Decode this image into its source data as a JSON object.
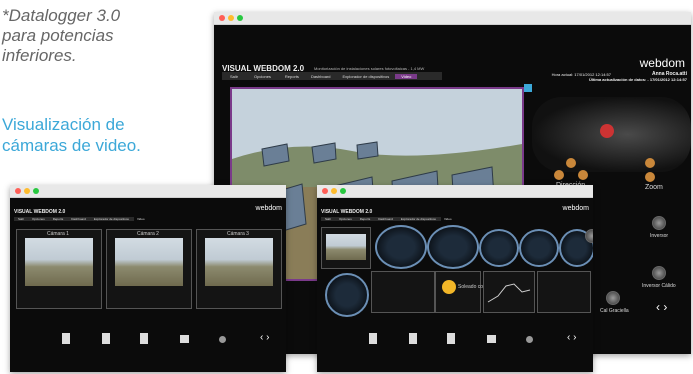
{
  "note": {
    "line1": "*Datalogger 3.0",
    "line2": "para potencias",
    "line3": "inferiores."
  },
  "heading": {
    "line1": "Visualización de",
    "line2": "cámaras de video."
  },
  "main_window": {
    "title": "VISUAL WEBDOM 2.0",
    "subtitle": "Monitorización de instalaciones solares fotovoltaicas - 1,4 MW",
    "brand": "webdom",
    "status_line1": "Hora actual: 17/01/2012 12:14:57",
    "status_user": "Anna Roca.atti",
    "status_line2": "Última actualización de datos: - 17/01/2012 12:14:57",
    "menu": [
      "Salir",
      "Opciones",
      "Reports",
      "Dashboard",
      "Explorador de dispositivos",
      "Video"
    ],
    "active_menu": "Video",
    "controls": {
      "direction": "Dirección",
      "zoom": "Zoom"
    }
  },
  "left_window": {
    "title": "VISUAL WEBDOM 2.0",
    "brand": "webdom",
    "menu": [
      "Salir",
      "Opciones",
      "Reports",
      "Dashboard",
      "Explorador de dispositivos",
      "Video"
    ],
    "cameras": [
      "Cámara 1",
      "Cámara 2",
      "Cámara 3"
    ]
  },
  "right_window": {
    "title": "VISUAL WEBDOM 2.0",
    "brand": "webdom",
    "menu": [
      "Salir",
      "Opciones",
      "Reports",
      "Dashboard",
      "Explorador de dispositivos",
      "Video"
    ],
    "weather": "Soleado con",
    "side_labels": {
      "top": "Inversor",
      "mid": "Inversor Cálido",
      "bottom": "Cal Graciella"
    }
  },
  "colors": {
    "accent": "#7a3a8a",
    "heading": "#3ca8d8",
    "gauge": "#6b8fb5"
  }
}
